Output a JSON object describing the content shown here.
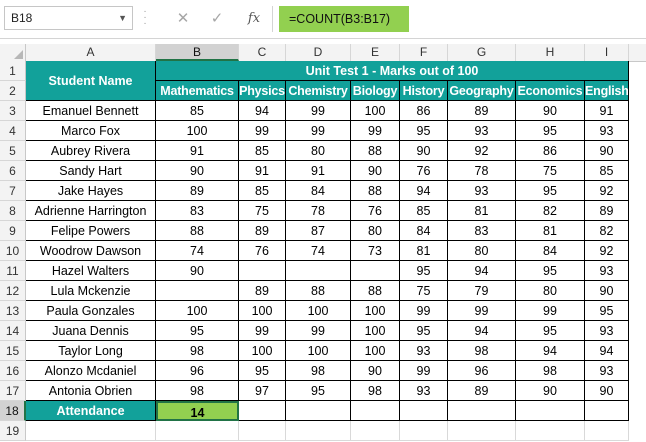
{
  "namebox": {
    "ref": "B18",
    "dropdown_icon": "chevron-down-icon"
  },
  "formula_bar": {
    "icons": [
      "more-options-icon",
      "cancel-x-icon",
      "confirm-check-icon",
      "insert-function-icon"
    ],
    "cancel_glyph": "✕",
    "confirm_glyph": "✓",
    "fx_glyph": "fx",
    "formula": "=COUNT(B3:B17)"
  },
  "columns": [
    "A",
    "B",
    "C",
    "D",
    "E",
    "F",
    "G",
    "H",
    "I"
  ],
  "selected_column": "B",
  "rows": [
    "1",
    "2",
    "3",
    "4",
    "5",
    "6",
    "7",
    "8",
    "9",
    "10",
    "11",
    "12",
    "13",
    "14",
    "15",
    "16",
    "17",
    "18",
    "19"
  ],
  "selected_row": "18",
  "table": {
    "name_header": "Student Name",
    "group_header": "Unit Test 1 - Marks out of 100",
    "subjects": [
      "Mathematics",
      "Physics",
      "Chemistry",
      "Biology",
      "History",
      "Geography",
      "Economics",
      "English"
    ],
    "students": [
      {
        "name": "Emanuel Bennett",
        "marks": [
          "85",
          "94",
          "99",
          "100",
          "86",
          "89",
          "90",
          "91"
        ]
      },
      {
        "name": "Marco Fox",
        "marks": [
          "100",
          "99",
          "99",
          "99",
          "95",
          "93",
          "95",
          "93"
        ]
      },
      {
        "name": "Aubrey Rivera",
        "marks": [
          "91",
          "85",
          "80",
          "88",
          "90",
          "92",
          "86",
          "90"
        ]
      },
      {
        "name": "Sandy Hart",
        "marks": [
          "90",
          "91",
          "91",
          "90",
          "76",
          "78",
          "75",
          "85"
        ]
      },
      {
        "name": "Jake Hayes",
        "marks": [
          "89",
          "85",
          "84",
          "88",
          "94",
          "93",
          "95",
          "92"
        ]
      },
      {
        "name": "Adrienne Harrington",
        "marks": [
          "83",
          "75",
          "78",
          "76",
          "85",
          "81",
          "82",
          "89"
        ]
      },
      {
        "name": "Felipe Powers",
        "marks": [
          "88",
          "89",
          "87",
          "80",
          "84",
          "83",
          "81",
          "82"
        ]
      },
      {
        "name": "Woodrow Dawson",
        "marks": [
          "74",
          "76",
          "74",
          "73",
          "81",
          "80",
          "84",
          "92"
        ]
      },
      {
        "name": "Hazel Walters",
        "marks": [
          "90",
          "",
          "",
          "",
          "95",
          "94",
          "95",
          "93"
        ]
      },
      {
        "name": "Lula Mckenzie",
        "marks": [
          "",
          "89",
          "88",
          "88",
          "75",
          "79",
          "80",
          "90"
        ]
      },
      {
        "name": "Paula Gonzales",
        "marks": [
          "100",
          "100",
          "100",
          "100",
          "99",
          "99",
          "99",
          "95"
        ]
      },
      {
        "name": "Juana Dennis",
        "marks": [
          "95",
          "99",
          "99",
          "100",
          "95",
          "94",
          "95",
          "93"
        ]
      },
      {
        "name": "Taylor Long",
        "marks": [
          "98",
          "100",
          "100",
          "100",
          "93",
          "98",
          "94",
          "94"
        ]
      },
      {
        "name": "Alonzo Mcdaniel",
        "marks": [
          "96",
          "95",
          "98",
          "90",
          "99",
          "96",
          "98",
          "93"
        ]
      },
      {
        "name": "Antonia Obrien",
        "marks": [
          "98",
          "97",
          "95",
          "98",
          "93",
          "89",
          "90",
          "90"
        ]
      }
    ],
    "attendance_label": "Attendance",
    "attendance_value": "14"
  },
  "colors": {
    "header_teal": "#12a19a",
    "highlight_green": "#92d050",
    "selection_green": "#217346"
  }
}
